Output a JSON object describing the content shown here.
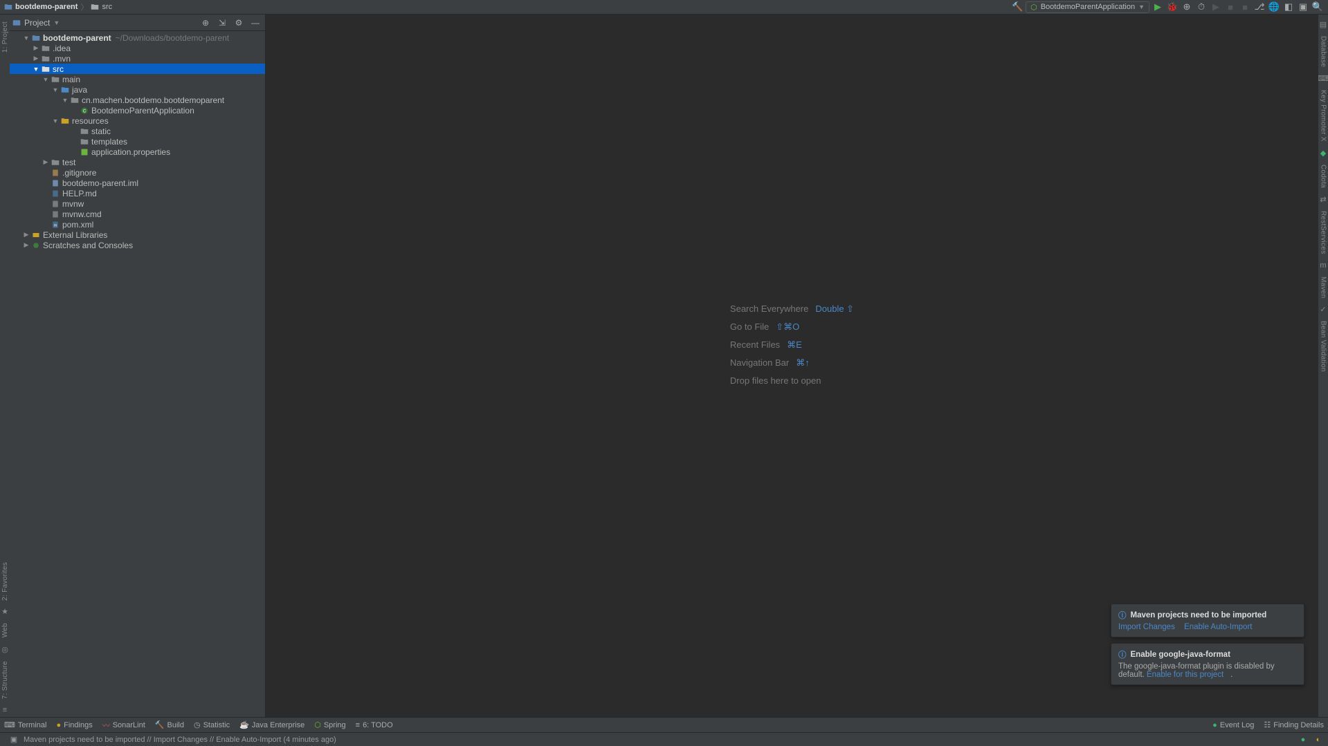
{
  "breadcrumb": {
    "root": "bootdemo-parent",
    "parts": [
      "src"
    ]
  },
  "run_config": {
    "name": "BootdemoParentApplication"
  },
  "project_panel": {
    "title": "Project"
  },
  "tree": {
    "root": {
      "name": "bootdemo-parent",
      "path": "~/Downloads/bootdemo-parent"
    },
    "idea": ".idea",
    "mvn": ".mvn",
    "src": "src",
    "main": "main",
    "java": "java",
    "pkg": "cn.machen.bootdemo.bootdemoparent",
    "app": "BootdemoParentApplication",
    "resources": "resources",
    "static": "static",
    "templates": "templates",
    "properties": "application.properties",
    "test": "test",
    "gitignore": ".gitignore",
    "iml": "bootdemo-parent.iml",
    "help": "HELP.md",
    "mvnw": "mvnw",
    "mvnwcmd": "mvnw.cmd",
    "pom": "pom.xml",
    "ext_lib": "External Libraries",
    "scratch": "Scratches and Consoles"
  },
  "welcome": {
    "search": "Search Everywhere",
    "search_key": "Double ⇧",
    "goto": "Go to File",
    "goto_key": "⇧⌘O",
    "recent": "Recent Files",
    "recent_key": "⌘E",
    "nav": "Navigation Bar",
    "nav_key": "⌘↑",
    "drop": "Drop files here to open"
  },
  "notifications": {
    "n1": {
      "title": "Maven projects need to be imported",
      "link1": "Import Changes",
      "link2": "Enable Auto-Import"
    },
    "n2": {
      "title": "Enable google-java-format",
      "body": "The google-java-format plugin is disabled by default. ",
      "link": "Enable for this project"
    }
  },
  "bottom": {
    "terminal": "Terminal",
    "findings": "Findings",
    "sonar": "SonarLint",
    "build": "Build",
    "statistic": "Statistic",
    "jee": "Java Enterprise",
    "spring": "Spring",
    "todo": "6: TODO",
    "eventlog": "Event Log",
    "finddetails": "Finding Details"
  },
  "status": {
    "msg": "Maven projects need to be imported // Import Changes // Enable Auto-Import (4 minutes ago)"
  },
  "left_tabs": {
    "project": "1: Project",
    "favorites": "2: Favorites",
    "web": "Web",
    "structure": "7: Structure"
  },
  "right_tabs": {
    "database": "Database",
    "keyp": "Key Promoter X",
    "codota": "Codota",
    "restservices": "RestServices",
    "maven": "Maven",
    "bv": "Bean Validation"
  }
}
